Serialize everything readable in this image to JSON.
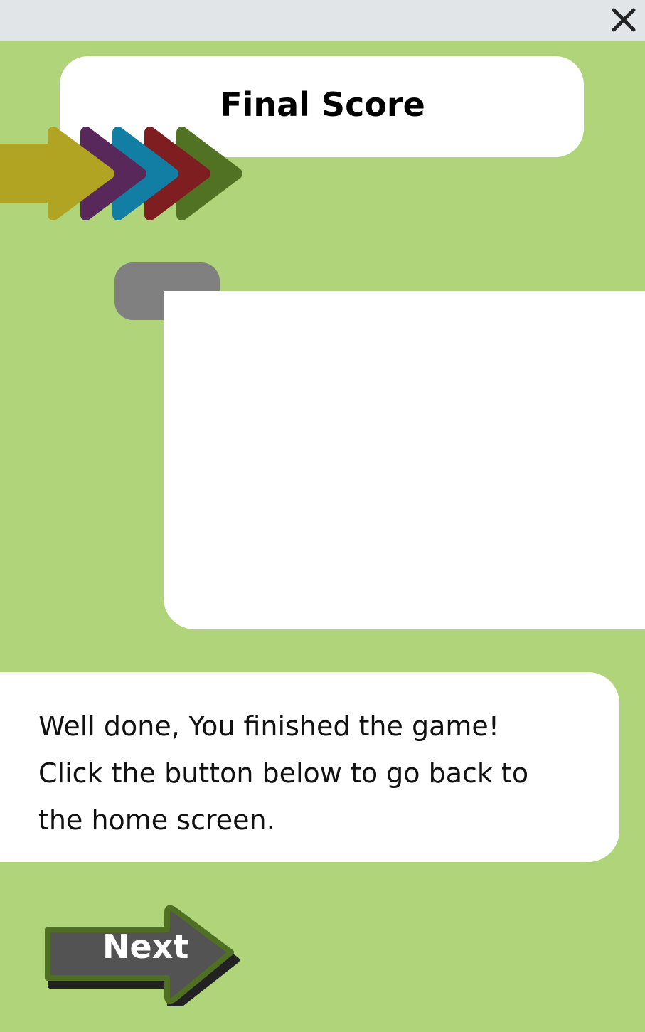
{
  "header": {
    "close_icon": "close-x-icon"
  },
  "title": "Final Score",
  "decoration": {
    "arrow_colors": [
      "#b2a423",
      "#58285a",
      "#127ea4",
      "#7f1e20",
      "#517222"
    ]
  },
  "message": {
    "lines": [
      "Well done, You finished the game!",
      "Click the button below to go back to",
      "the home screen."
    ]
  },
  "next_button": {
    "label": "Next",
    "fill": "#535353",
    "border": "#4f7023"
  }
}
